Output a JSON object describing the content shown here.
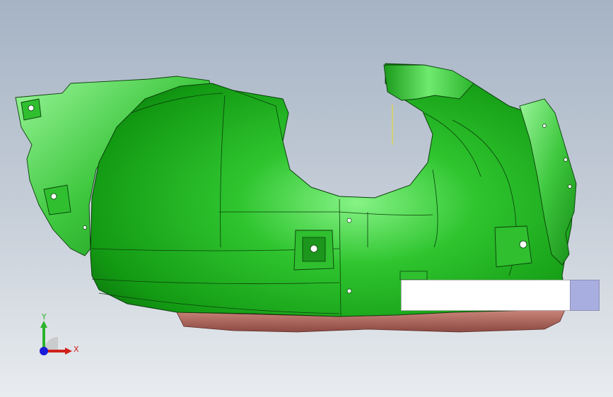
{
  "viewport": {
    "background_top": "#a5b3c4",
    "background_bottom": "#e9ecef"
  },
  "model": {
    "name_icon": "cad-part-icon",
    "main_color": "#1fae1f",
    "highlight_color": "#7ef07e",
    "dark_color": "#0c6a0c",
    "edge_color": "#0b3f0b",
    "trim_color": "#b46c62"
  },
  "triad": {
    "x_label": "X",
    "y_label": "Y",
    "x_color": "#d0201a",
    "y_color": "#2bb32b",
    "origin_color": "#1b1bd8"
  },
  "overlay": {
    "box_color": "#ffffff",
    "tab_color": "#a9aee0"
  }
}
